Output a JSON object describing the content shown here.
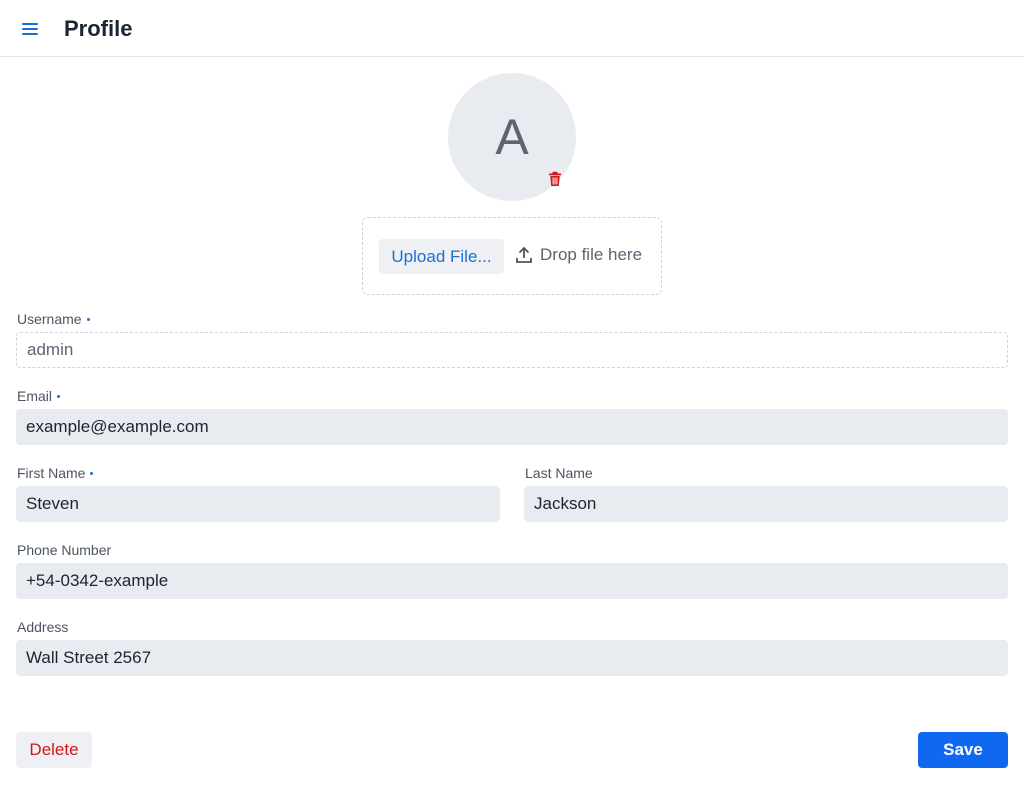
{
  "header": {
    "title": "Profile",
    "menu_icon": "hamburger-menu-icon"
  },
  "avatar": {
    "initial": "A",
    "delete_icon": "trash-icon"
  },
  "upload": {
    "button_label": "Upload File...",
    "drop_hint": "Drop file here",
    "icon": "upload-icon"
  },
  "form": {
    "username": {
      "label": "Username",
      "value": "admin",
      "required": true,
      "readonly": true
    },
    "email": {
      "label": "Email",
      "value": "example@example.com",
      "required": true
    },
    "first_name": {
      "label": "First Name",
      "value": "Steven",
      "required": true
    },
    "last_name": {
      "label": "Last Name",
      "value": "Jackson",
      "required": false
    },
    "phone": {
      "label": "Phone Number",
      "value": "+54-0342-example",
      "required": false
    },
    "address": {
      "label": "Address",
      "value": "Wall Street 2567",
      "required": false
    }
  },
  "actions": {
    "delete_label": "Delete",
    "save_label": "Save"
  },
  "colors": {
    "accent": "#1168f0",
    "link": "#1a6fd6",
    "danger": "#d0171a",
    "field_background": "#e8ebef"
  }
}
